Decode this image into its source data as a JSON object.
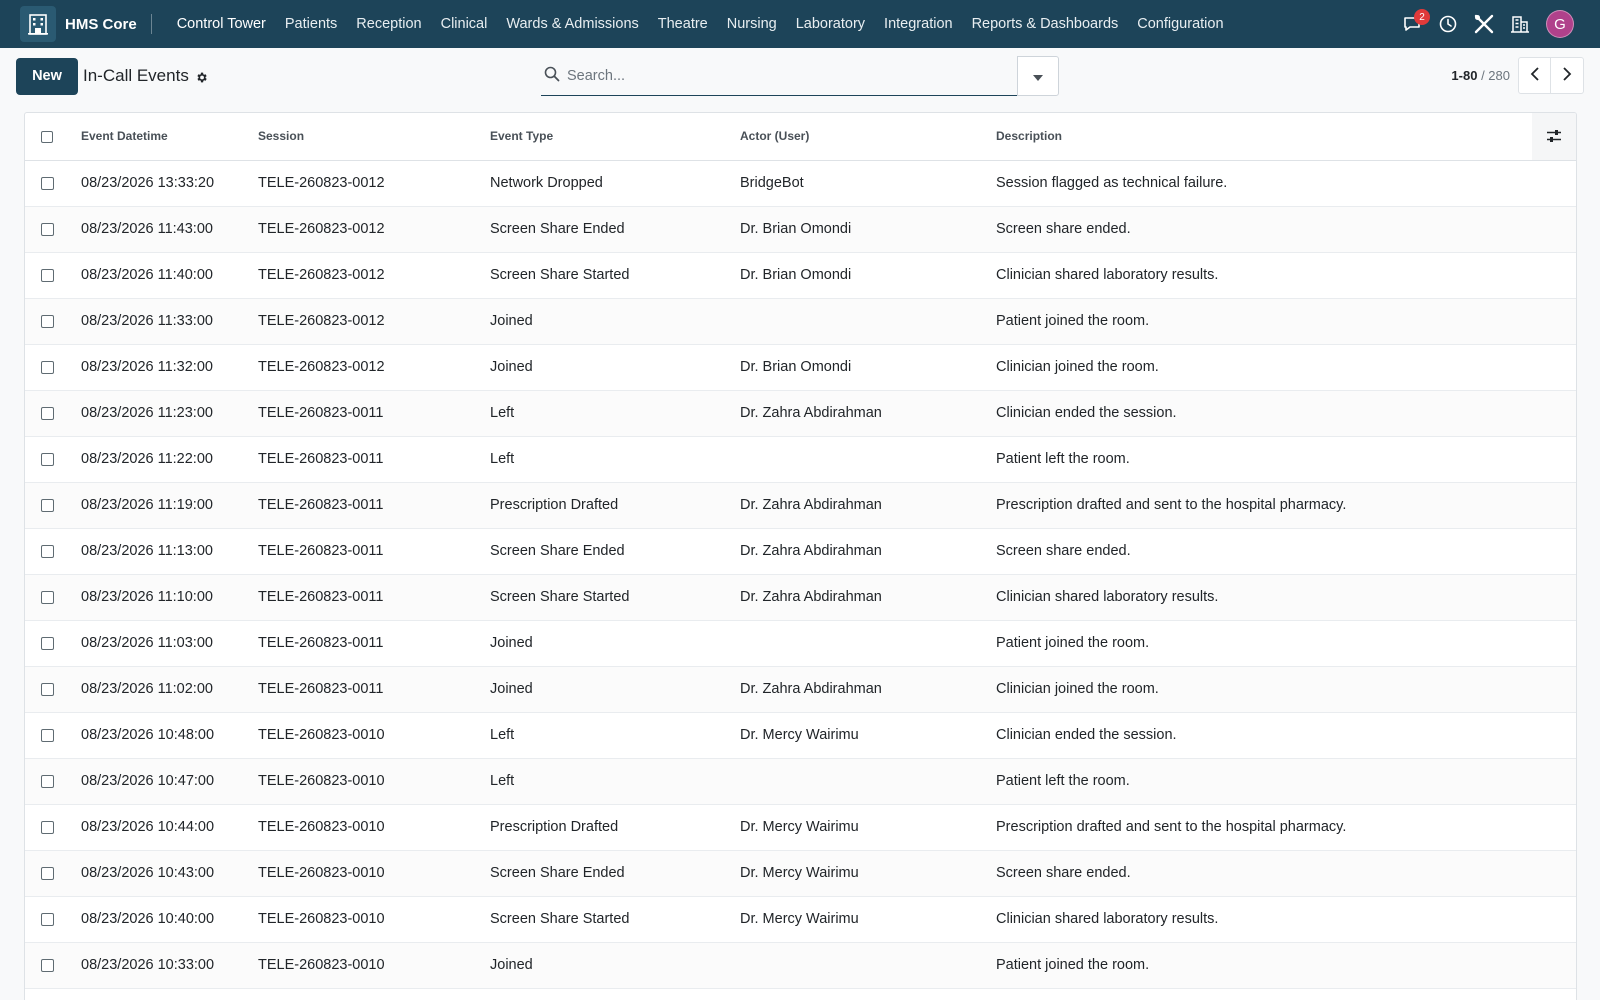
{
  "navbar": {
    "brand": "HMS Core",
    "menu": [
      "Control Tower",
      "Patients",
      "Reception",
      "Clinical",
      "Wards & Admissions",
      "Theatre",
      "Nursing",
      "Laboratory",
      "Integration",
      "Reports & Dashboards",
      "Configuration"
    ],
    "messages_badge": "2",
    "avatar_letter": "G",
    "colors": {
      "bar": "#1d4459",
      "avatar": "#b0418b",
      "badge": "#e03a3a"
    }
  },
  "control_panel": {
    "new_label": "New",
    "title": "In-Call Events",
    "search_placeholder": "Search...",
    "pager_range": "1-80",
    "pager_total": "/ 280"
  },
  "table": {
    "columns": [
      "Event Datetime",
      "Session",
      "Event Type",
      "Actor (User)",
      "Description"
    ],
    "rows": [
      [
        "08/23/2026 13:33:20",
        "TELE-260823-0012",
        "Network Dropped",
        "BridgeBot",
        "Session flagged as technical failure."
      ],
      [
        "08/23/2026 11:43:00",
        "TELE-260823-0012",
        "Screen Share Ended",
        "Dr. Brian Omondi",
        "Screen share ended."
      ],
      [
        "08/23/2026 11:40:00",
        "TELE-260823-0012",
        "Screen Share Started",
        "Dr. Brian Omondi",
        "Clinician shared laboratory results."
      ],
      [
        "08/23/2026 11:33:00",
        "TELE-260823-0012",
        "Joined",
        "",
        "Patient joined the room."
      ],
      [
        "08/23/2026 11:32:00",
        "TELE-260823-0012",
        "Joined",
        "Dr. Brian Omondi",
        "Clinician joined the room."
      ],
      [
        "08/23/2026 11:23:00",
        "TELE-260823-0011",
        "Left",
        "Dr. Zahra Abdirahman",
        "Clinician ended the session."
      ],
      [
        "08/23/2026 11:22:00",
        "TELE-260823-0011",
        "Left",
        "",
        "Patient left the room."
      ],
      [
        "08/23/2026 11:19:00",
        "TELE-260823-0011",
        "Prescription Drafted",
        "Dr. Zahra Abdirahman",
        "Prescription drafted and sent to the hospital pharmacy."
      ],
      [
        "08/23/2026 11:13:00",
        "TELE-260823-0011",
        "Screen Share Ended",
        "Dr. Zahra Abdirahman",
        "Screen share ended."
      ],
      [
        "08/23/2026 11:10:00",
        "TELE-260823-0011",
        "Screen Share Started",
        "Dr. Zahra Abdirahman",
        "Clinician shared laboratory results."
      ],
      [
        "08/23/2026 11:03:00",
        "TELE-260823-0011",
        "Joined",
        "",
        "Patient joined the room."
      ],
      [
        "08/23/2026 11:02:00",
        "TELE-260823-0011",
        "Joined",
        "Dr. Zahra Abdirahman",
        "Clinician joined the room."
      ],
      [
        "08/23/2026 10:48:00",
        "TELE-260823-0010",
        "Left",
        "Dr. Mercy Wairimu",
        "Clinician ended the session."
      ],
      [
        "08/23/2026 10:47:00",
        "TELE-260823-0010",
        "Left",
        "",
        "Patient left the room."
      ],
      [
        "08/23/2026 10:44:00",
        "TELE-260823-0010",
        "Prescription Drafted",
        "Dr. Mercy Wairimu",
        "Prescription drafted and sent to the hospital pharmacy."
      ],
      [
        "08/23/2026 10:43:00",
        "TELE-260823-0010",
        "Screen Share Ended",
        "Dr. Mercy Wairimu",
        "Screen share ended."
      ],
      [
        "08/23/2026 10:40:00",
        "TELE-260823-0010",
        "Screen Share Started",
        "Dr. Mercy Wairimu",
        "Clinician shared laboratory results."
      ],
      [
        "08/23/2026 10:33:00",
        "TELE-260823-0010",
        "Joined",
        "",
        "Patient joined the room."
      ]
    ]
  },
  "icons": {
    "app": "hospital-building-icon",
    "messages": "chat-bubble-icon",
    "activity": "clock-icon",
    "debug": "tools-icon",
    "company": "building-icon",
    "settings": "gear-icon",
    "search": "search-icon",
    "search_toggle": "caret-down-icon",
    "prev": "chevron-left-icon",
    "next": "chevron-right-icon",
    "optional_columns": "sliders-icon"
  }
}
